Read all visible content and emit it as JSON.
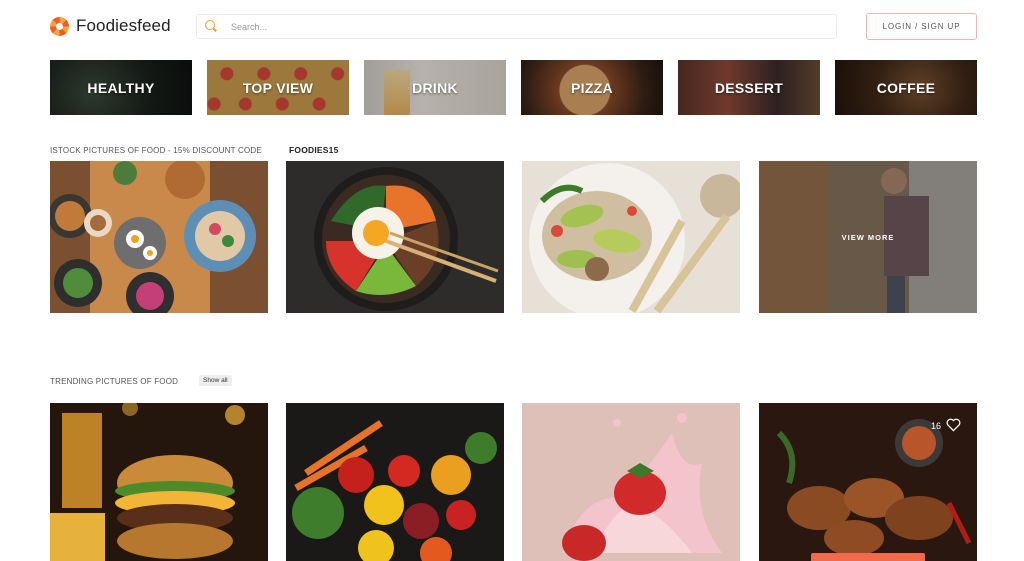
{
  "header": {
    "logo_text": "Foodiesfeed",
    "search_placeholder": "Search...",
    "login_label": "LOGIN / SIGN UP"
  },
  "categories": [
    {
      "label": "HEALTHY"
    },
    {
      "label": "TOP VIEW"
    },
    {
      "label": "DRINK"
    },
    {
      "label": "PIZZA"
    },
    {
      "label": "DESSERT"
    },
    {
      "label": "COFFEE"
    }
  ],
  "istock": {
    "title": "ISTOCK PICTURES OF FOOD - 15% DISCOUNT CODE",
    "code": "FOODIES15",
    "view_more": "VIEW MORE"
  },
  "trending": {
    "title": "TRENDING PICTURES OF FOOD",
    "show_all": "Show all",
    "likes": "16"
  },
  "colors": {
    "accent_orange": "#f29b38",
    "button_border": "#f0b4a8",
    "highlight_bar": "#f36a4a"
  },
  "icons": [
    "foodiesfeed-logo-icon",
    "search-icon",
    "heart-icon"
  ]
}
